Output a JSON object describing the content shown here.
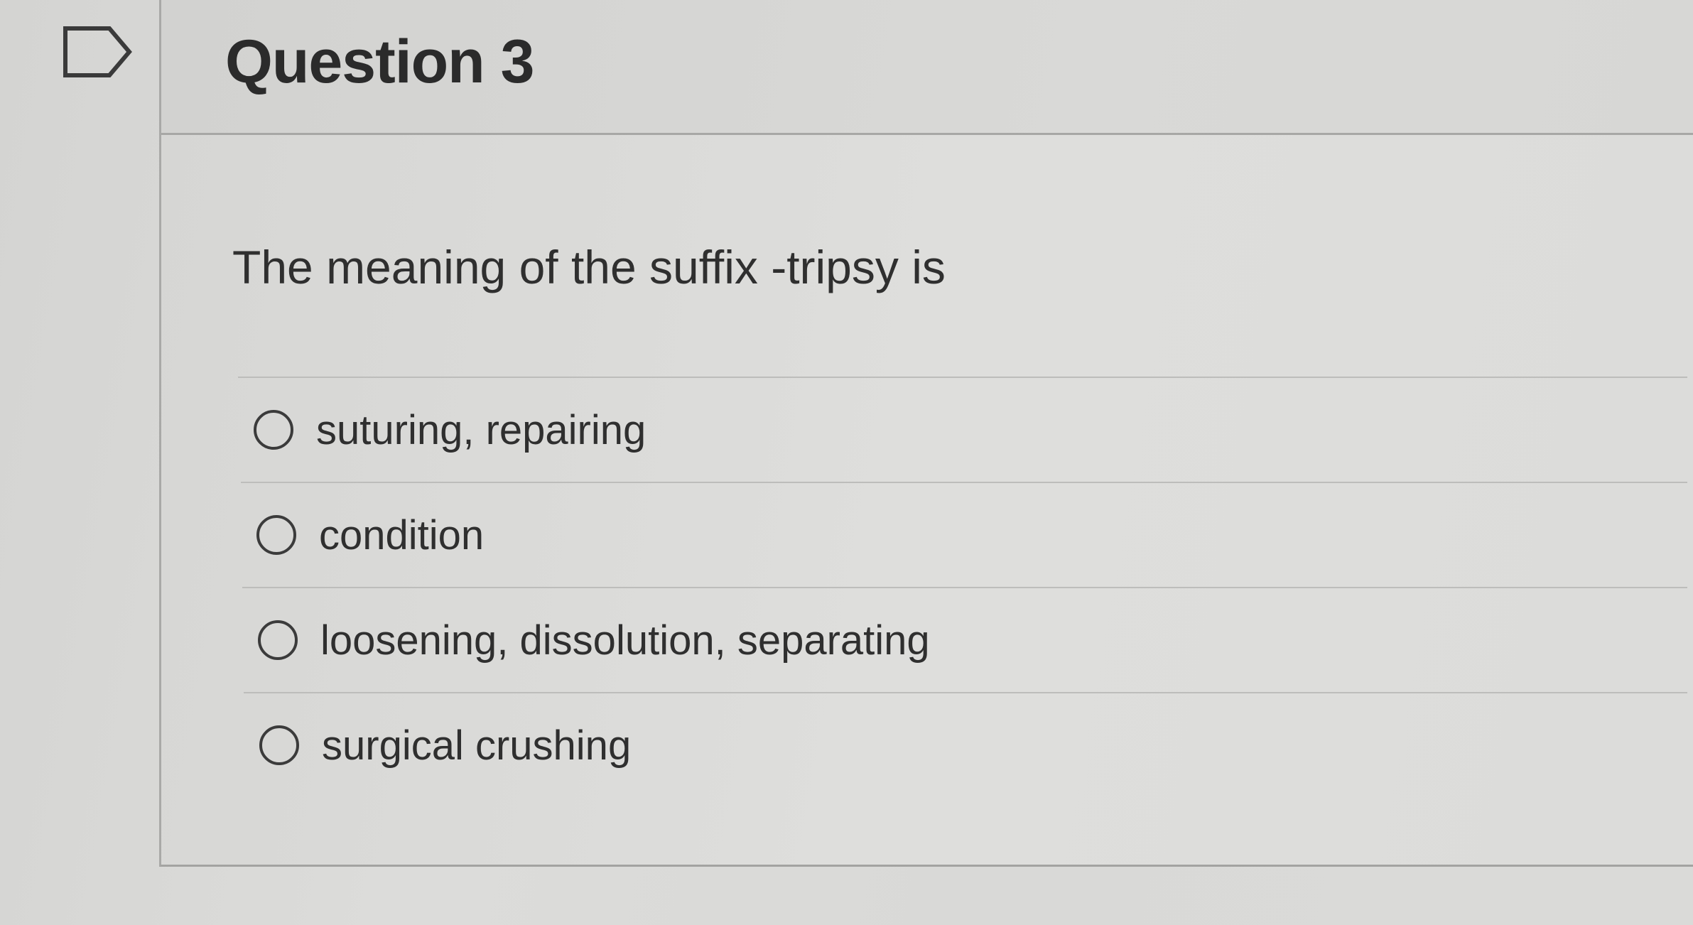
{
  "question": {
    "title": "Question 3",
    "text": "The meaning of the suffix -tripsy is",
    "answers": [
      {
        "label": "suturing, repairing"
      },
      {
        "label": "condition"
      },
      {
        "label": "loosening, dissolution, separating"
      },
      {
        "label": "surgical crushing"
      }
    ]
  },
  "icons": {
    "flag": "flag-outline-icon",
    "radio": "radio-unselected-icon"
  },
  "colors": {
    "text": "#2f2f2f",
    "border": "#a7a7a5",
    "background": "#dcdcda"
  }
}
